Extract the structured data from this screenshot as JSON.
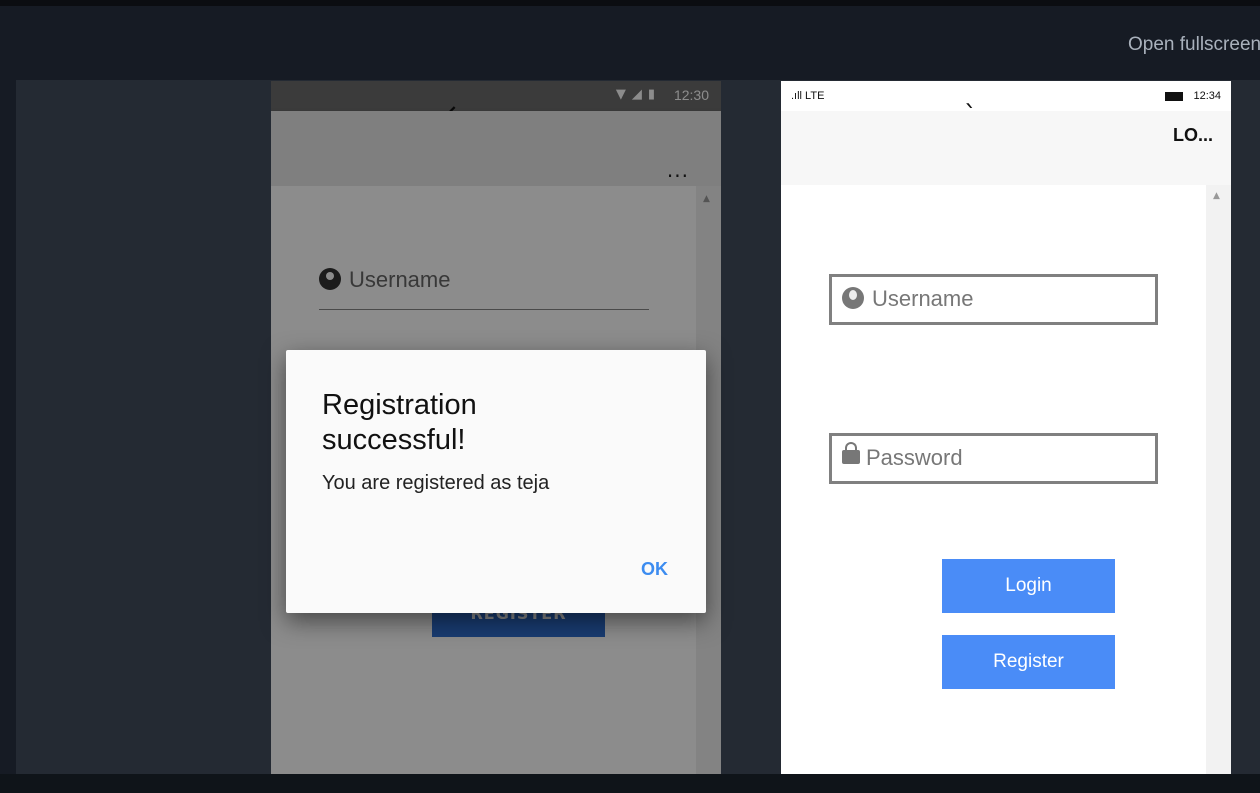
{
  "header": {
    "fullscreen_label": "Open fullscreen"
  },
  "android": {
    "status_time": "12:30",
    "username_placeholder": "Username",
    "register_label": "REGISTER",
    "menu_label": "...",
    "dialog": {
      "title": "Registration successful!",
      "message": "You are registered as teja",
      "ok_label": "OK"
    }
  },
  "windows": {
    "signal_label": ".ıll LTE",
    "status_time": "12:34",
    "title": "LO...",
    "username_placeholder": "Username",
    "password_placeholder": "Password",
    "login_label": "Login",
    "register_label": "Register"
  }
}
